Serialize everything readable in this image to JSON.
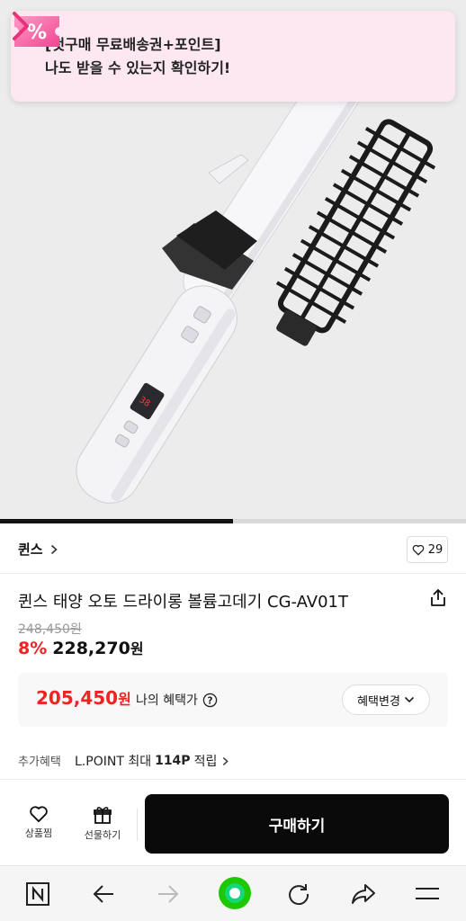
{
  "promo": {
    "line1": "[첫구매 무료배송권+포인트]",
    "line2": "나도 받을 수 있는지 확인하기!",
    "icon": "percent-coupon-icon",
    "accent": "#e8337a"
  },
  "gallery": {
    "progress_fraction": 0.5
  },
  "brand": {
    "name": "퀸스",
    "likes": "29"
  },
  "product": {
    "title": "퀸스 태양 오토 드라이롱 볼륨고데기 CG-AV01T",
    "original_price": "248,450원",
    "discount": "8%",
    "price": "228,270",
    "currency": "원"
  },
  "benefit": {
    "price": "205,450",
    "currency": "원",
    "label": "나의 혜택가",
    "change_label": "혜택변경"
  },
  "extra": {
    "label": "추가혜택",
    "detail_prefix": "L.POINT 최대",
    "detail_amount": "114P",
    "detail_suffix": "적립"
  },
  "bottom": {
    "wish_label": "상품찜",
    "gift_label": "선물하기",
    "buy_label": "구매하기"
  },
  "colors": {
    "sale_red": "#f02222",
    "buy_black": "#0a0a0a",
    "nav_green": "#1ec800"
  }
}
